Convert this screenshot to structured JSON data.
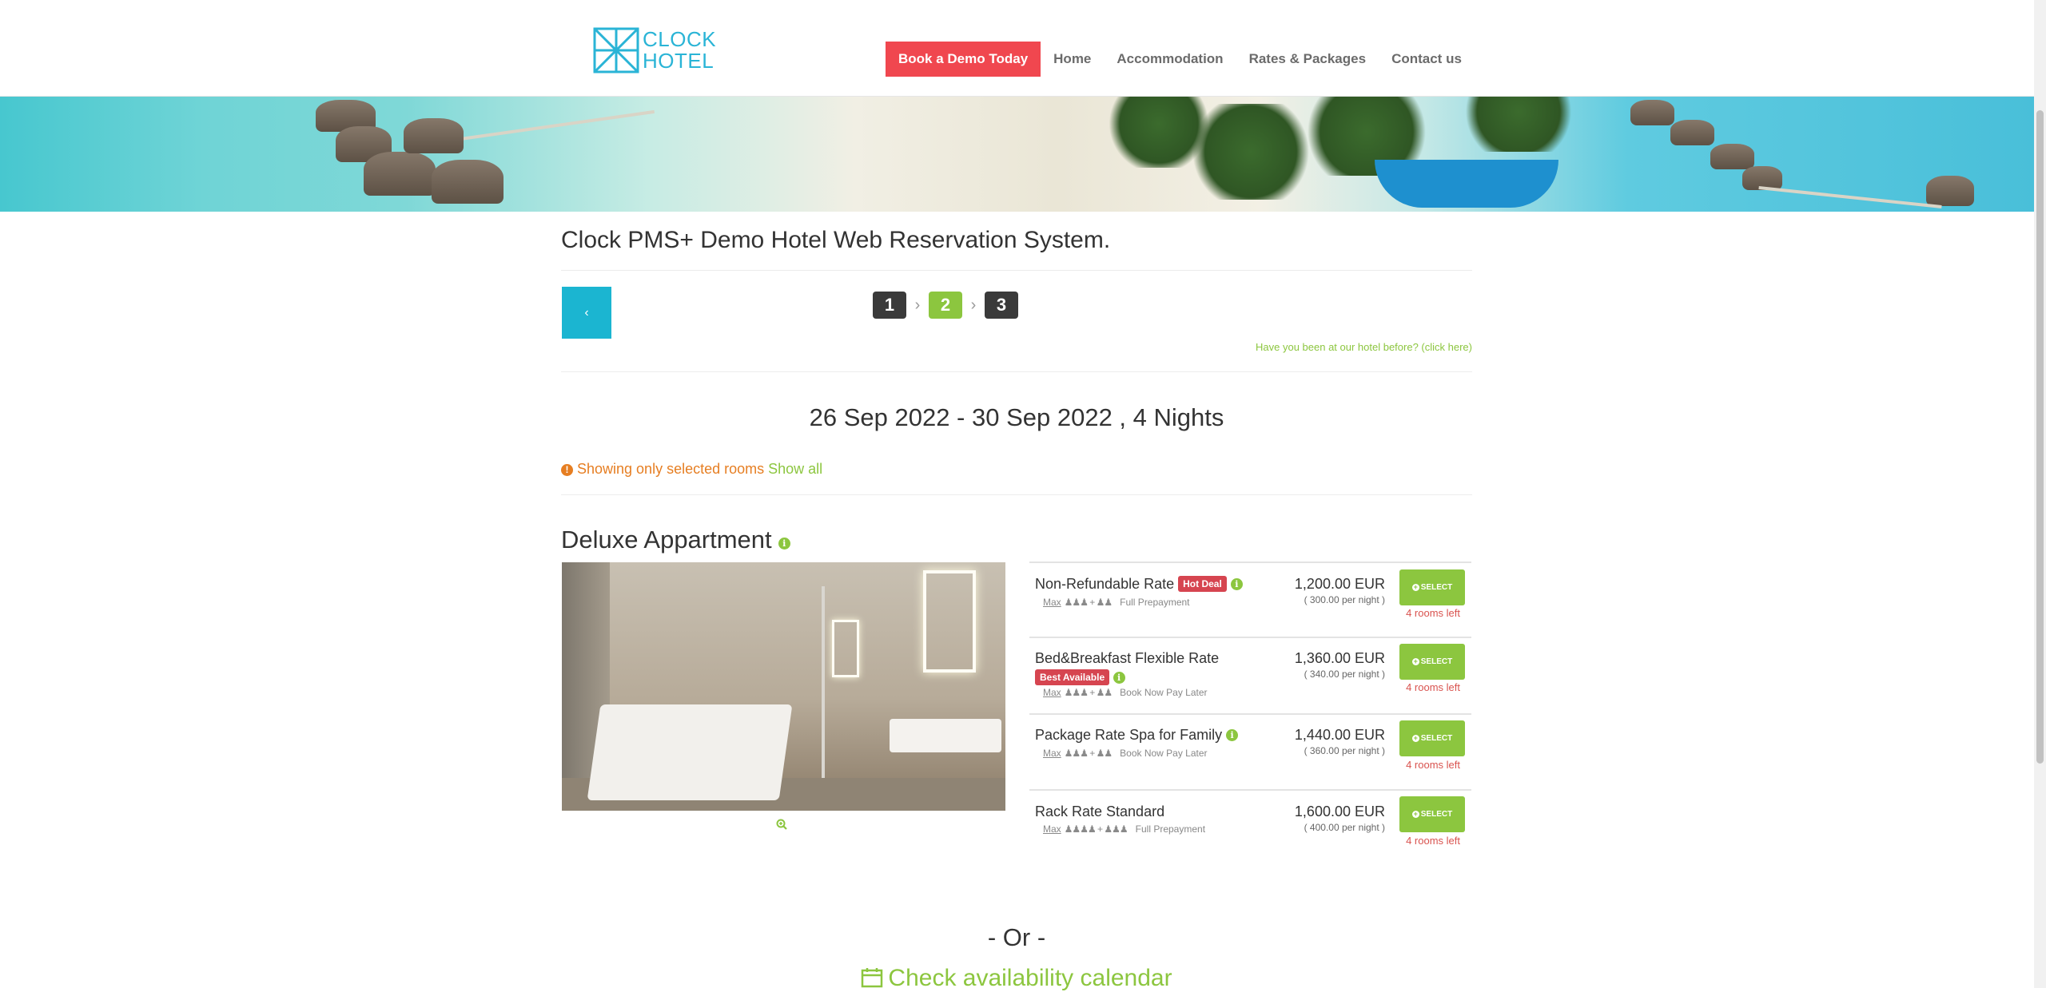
{
  "header": {
    "logo_line1": "CLOCK",
    "logo_line2": "HOTEL",
    "demo_button": "Book a Demo Today",
    "nav": [
      "Home",
      "Accommodation",
      "Rates & Packages",
      "Contact us"
    ]
  },
  "page_title": "Clock PMS+ Demo Hotel Web Reservation System.",
  "back_button": "‹",
  "steps": [
    "1",
    "2",
    "3"
  ],
  "active_step": "2",
  "been_before_link": "Have you been at our hotel before? (click here)",
  "stay_dates": "26 Sep 2022 - 30 Sep 2022 , 4 Nights",
  "notice": {
    "text": "Showing only selected rooms",
    "show_all": "Show all"
  },
  "room": {
    "name": "Deluxe Appartment",
    "rates": [
      {
        "name": "Non-Refundable Rate",
        "badge": "Hot Deal",
        "max": "Max",
        "occupancy": "♟♟♟ + ♟♟",
        "policy": "Full Prepayment",
        "price": "1,200.00 EUR",
        "per_night": "( 300.00 per night )",
        "select": "SELECT",
        "availability": "4 rooms left"
      },
      {
        "name": "Bed&Breakfast Flexible Rate",
        "badge": "Best Available",
        "max": "Max",
        "occupancy": "♟♟♟ + ♟♟",
        "policy": "Book Now Pay Later",
        "price": "1,360.00 EUR",
        "per_night": "( 340.00 per night )",
        "select": "SELECT",
        "availability": "4 rooms left"
      },
      {
        "name": "Package Rate Spa for Family",
        "badge": "",
        "max": "Max",
        "occupancy": "♟♟♟ + ♟♟",
        "policy": "Book Now Pay Later",
        "price": "1,440.00 EUR",
        "per_night": "( 360.00 per night )",
        "select": "SELECT",
        "availability": "4 rooms left"
      },
      {
        "name": "Rack Rate Standard",
        "badge": "",
        "max": "Max",
        "occupancy": "♟♟♟♟ + ♟♟♟",
        "policy": "Full Prepayment",
        "price": "1,600.00 EUR",
        "per_night": "( 400.00 per night )",
        "select": "SELECT",
        "availability": "4 rooms left"
      }
    ]
  },
  "or_text": "- Or -",
  "calendar_link": "Check availability calendar",
  "colors": {
    "accent_green": "#8cc63f",
    "demo_red": "#f0474f",
    "back_cyan": "#1bb5d1",
    "badge_red": "#d64550",
    "notice_orange": "#e67e22"
  }
}
